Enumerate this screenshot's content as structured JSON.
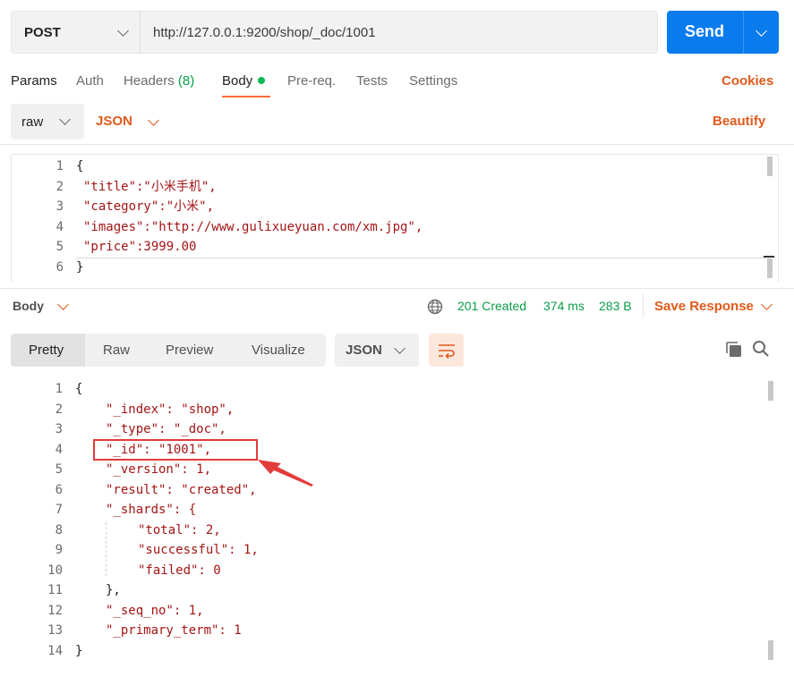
{
  "request": {
    "method": "POST",
    "url": "http://127.0.0.1:9200/shop/_doc/1001",
    "send_label": "Send"
  },
  "tabs": {
    "params": "Params",
    "auth": "Auth",
    "headers": "Headers",
    "headers_count": "(8)",
    "body": "Body",
    "prereq": "Pre-req.",
    "tests": "Tests",
    "settings": "Settings",
    "cookies": "Cookies"
  },
  "body_options": {
    "mode": "raw",
    "format": "JSON",
    "beautify": "Beautify"
  },
  "request_body": {
    "line_numbers": [
      "1",
      "2",
      "3",
      "4",
      "5",
      "6"
    ],
    "lines": [
      "{",
      "\"title\":\"小米手机\",",
      "\"category\":\"小米\",",
      "\"images\":\"http://www.gulixueyuan.com/xm.jpg\",",
      "\"price\":3999.00",
      "}"
    ]
  },
  "response": {
    "section_label": "Body",
    "status": "201 Created",
    "time": "374 ms",
    "size": "283 B",
    "save_label": "Save Response",
    "views": [
      "Pretty",
      "Raw",
      "Preview",
      "Visualize"
    ],
    "format": "JSON",
    "line_numbers": [
      "1",
      "2",
      "3",
      "4",
      "5",
      "6",
      "7",
      "8",
      "9",
      "10",
      "11",
      "12",
      "13",
      "14"
    ],
    "lines": [
      "{",
      "\"_index\": \"shop\",",
      "\"_type\": \"_doc\",",
      "\"_id\": \"1001\",",
      "\"_version\": 1,",
      "\"result\": \"created\",",
      "\"_shards\": {",
      "\"total\": 2,",
      "\"successful\": 1,",
      "\"failed\": 0",
      "},",
      "\"_seq_no\": 1,",
      "\"_primary_term\": 1",
      "}"
    ]
  },
  "colors": {
    "accent": "#ff6c37",
    "send": "#097bed",
    "status_ok": "#0a9e48",
    "annotation": "#e23b3b"
  }
}
